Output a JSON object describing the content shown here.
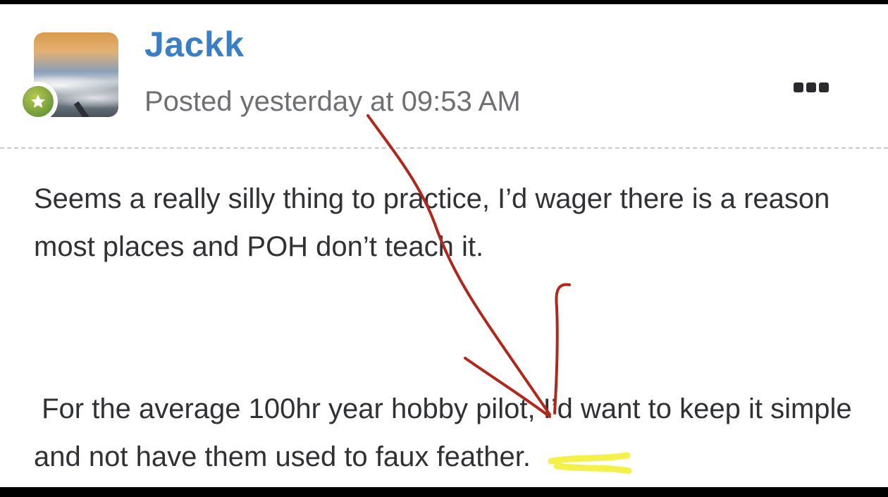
{
  "post": {
    "username": "Jackk",
    "posted": "Posted yesterday at 09:53 AM",
    "paragraphs": [
      "Seems a really silly thing to practice, I’d wager there is a reason most places and POH don’t teach it.",
      " For the average 100hr year hobby pilot, I’d want to keep it simple and not have them used to faux feather."
    ]
  },
  "icons": {
    "more": "more-options-icon",
    "badge": "star-badge-icon"
  },
  "colors": {
    "username": "#3a7fc6",
    "annotation_arrow": "#b0281c",
    "annotation_highlight": "#f2f02a"
  }
}
